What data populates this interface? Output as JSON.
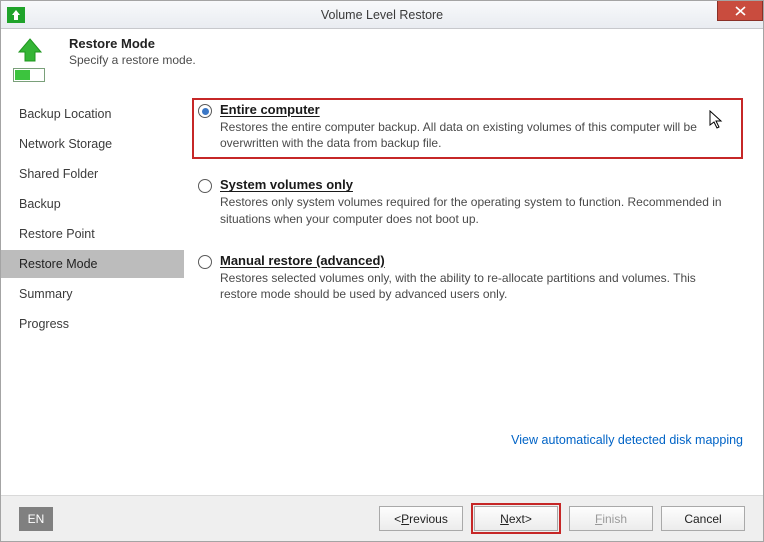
{
  "window": {
    "title": "Volume Level Restore",
    "lang": "EN"
  },
  "header": {
    "title": "Restore Mode",
    "subtitle": "Specify a restore mode."
  },
  "sidebar": {
    "items": [
      {
        "label": "Backup Location",
        "active": false
      },
      {
        "label": "Network Storage",
        "active": false
      },
      {
        "label": "Shared Folder",
        "active": false
      },
      {
        "label": "Backup",
        "active": false
      },
      {
        "label": "Restore Point",
        "active": false
      },
      {
        "label": "Restore Mode",
        "active": true
      },
      {
        "label": "Summary",
        "active": false
      },
      {
        "label": "Progress",
        "active": false
      }
    ]
  },
  "options": {
    "entire": {
      "title": "Entire computer",
      "desc": "Restores the entire computer backup. All data on existing volumes of this computer will be overwritten with the data from backup file."
    },
    "system": {
      "title": "System volumes only",
      "desc": "Restores only system volumes required for the operating system to function. Recommended in situations when your computer does not boot up."
    },
    "manual": {
      "title": "Manual restore (advanced)",
      "desc": "Restores selected volumes only, with the ability to re-allocate partitions and volumes. This restore mode should be used by advanced users only."
    }
  },
  "link": "View automatically detected disk mapping",
  "buttons": {
    "previous_prefix": "< ",
    "previous": "revious",
    "next": "ext",
    "next_prefix": "",
    "next_suffix": " >",
    "finish": "inish",
    "cancel": "Cancel"
  }
}
